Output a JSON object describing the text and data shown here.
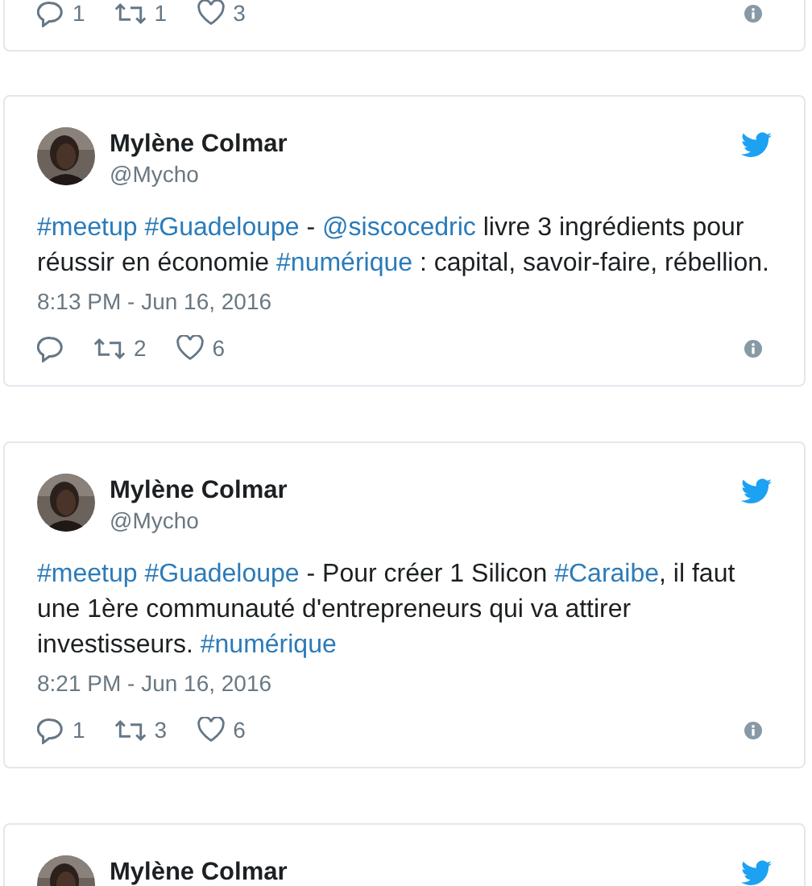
{
  "tweets": [
    {
      "kind": "partial",
      "actions": {
        "reply": "1",
        "retweet": "1",
        "like": "3"
      }
    },
    {
      "kind": "full",
      "name": "Mylène Colmar",
      "handle": "@Mycho",
      "text": [
        {
          "kind": "link",
          "text": "#meetup"
        },
        {
          "kind": "link",
          "text": "#Guadeloupe"
        },
        {
          "kind": "plain",
          "text": " - "
        },
        {
          "kind": "link",
          "text": "@siscocedric"
        },
        {
          "kind": "plain",
          "text": " livre 3 ingrédients pour réussir en économie "
        },
        {
          "kind": "link",
          "text": "#numérique"
        },
        {
          "kind": "plain",
          "text": " : capital, savoir-faire, rébellion."
        }
      ],
      "time": "8:13 PM - Jun 16, 2016",
      "actions": {
        "retweet": "2",
        "like": "6"
      }
    },
    {
      "kind": "full",
      "name": "Mylène Colmar",
      "handle": "@Mycho",
      "text": [
        {
          "kind": "link",
          "text": "#meetup"
        },
        {
          "kind": "link",
          "text": "#Guadeloupe"
        },
        {
          "kind": "plain",
          "text": " - Pour créer 1 Silicon "
        },
        {
          "kind": "link",
          "text": "#Caraibe"
        },
        {
          "kind": "plain",
          "text": ", il faut une 1ère communauté d'entrepreneurs qui va attirer investisseurs. "
        },
        {
          "kind": "link",
          "text": "#numérique"
        }
      ],
      "time": "8:21 PM - Jun 16, 2016",
      "actions": {
        "reply": "1",
        "retweet": "3",
        "like": "6"
      }
    },
    {
      "kind": "header",
      "name": "Mylène Colmar"
    }
  ]
}
